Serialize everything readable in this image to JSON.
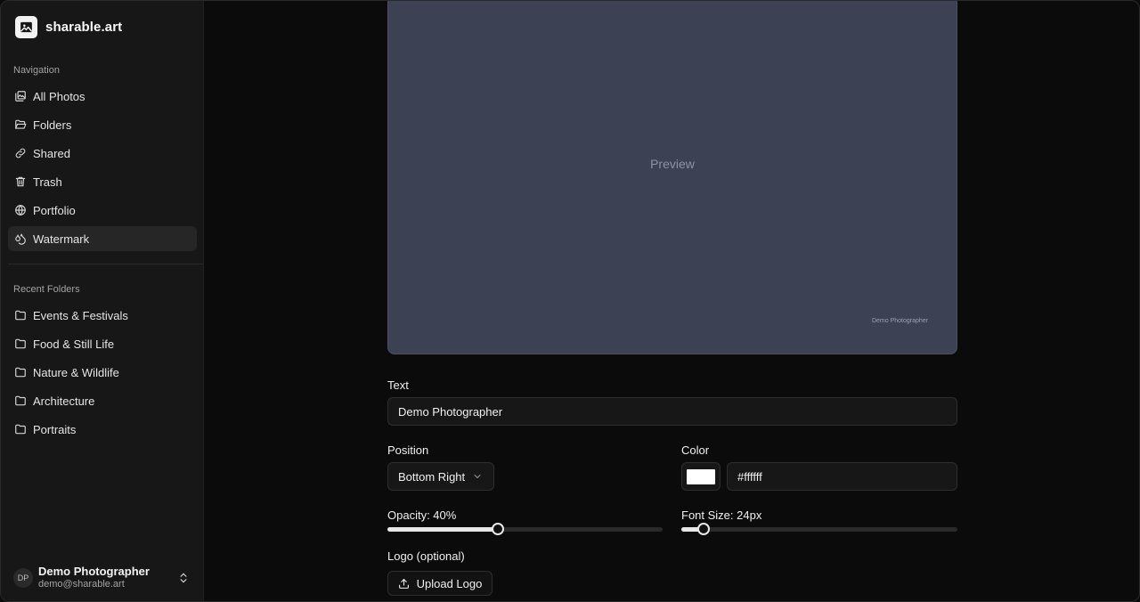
{
  "brand": {
    "name": "sharable.art",
    "icon": "image-icon"
  },
  "navigation": {
    "label": "Navigation",
    "items": [
      {
        "label": "All Photos",
        "icon": "images-icon"
      },
      {
        "label": "Folders",
        "icon": "folder-open-icon"
      },
      {
        "label": "Shared",
        "icon": "link-icon"
      },
      {
        "label": "Trash",
        "icon": "trash-icon"
      },
      {
        "label": "Portfolio",
        "icon": "globe-icon"
      },
      {
        "label": "Watermark",
        "icon": "droplets-icon",
        "active": true
      }
    ]
  },
  "recent_folders": {
    "label": "Recent Folders",
    "items": [
      {
        "label": "Events & Festivals",
        "icon": "folder-icon"
      },
      {
        "label": "Food & Still Life",
        "icon": "folder-icon"
      },
      {
        "label": "Nature & Wildlife",
        "icon": "folder-icon"
      },
      {
        "label": "Architecture",
        "icon": "folder-icon"
      },
      {
        "label": "Portraits",
        "icon": "folder-icon"
      }
    ]
  },
  "user": {
    "initials": "DP",
    "name": "Demo Photographer",
    "email": "demo@sharable.art"
  },
  "preview": {
    "label": "Preview",
    "watermark_text": "Demo Photographer",
    "background_color": "#3c4253"
  },
  "form": {
    "text_label": "Text",
    "text_value": "Demo Photographer",
    "position_label": "Position",
    "position_value": "Bottom Right",
    "color_label": "Color",
    "color_value": "#ffffff",
    "opacity_label": "Opacity: 40%",
    "opacity_value": 0.4,
    "font_size_label": "Font Size: 24px",
    "font_size_value": 0.08,
    "logo_label": "Logo (optional)",
    "upload_button": "Upload Logo"
  }
}
